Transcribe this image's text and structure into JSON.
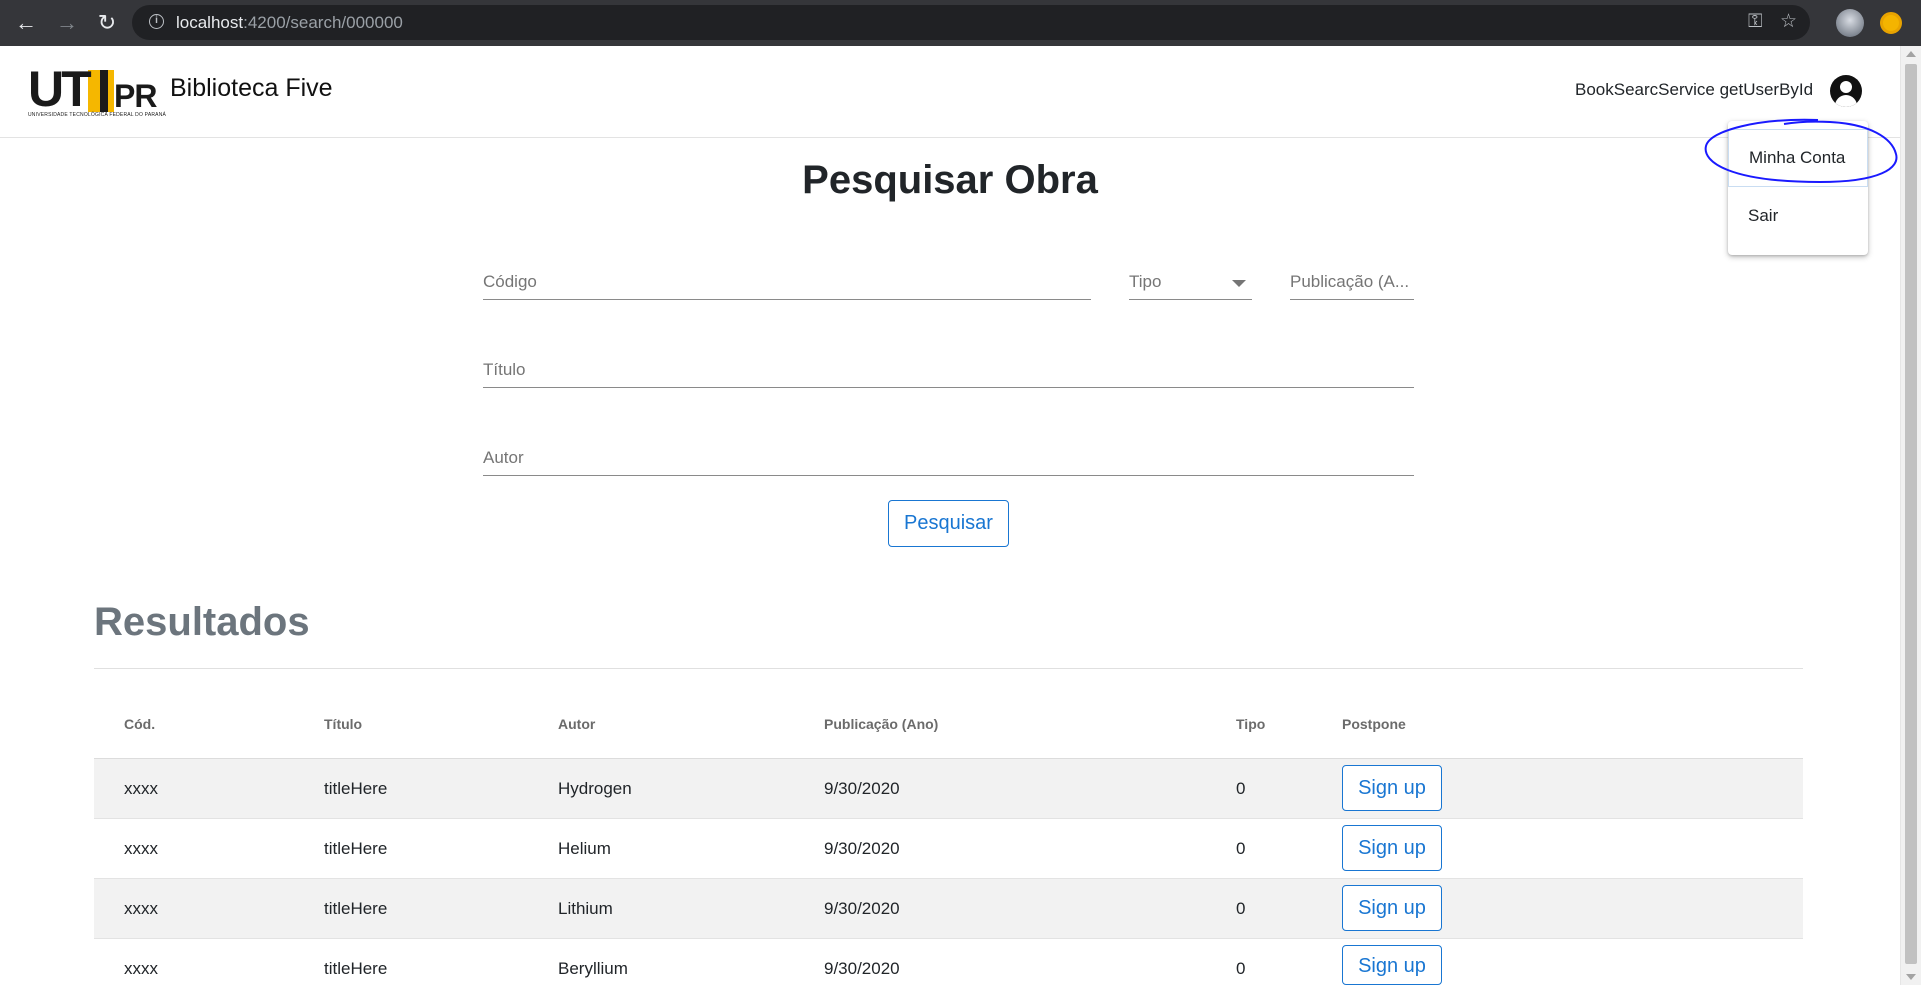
{
  "browser": {
    "url_host": "localhost",
    "url_path": ":4200/search/000000",
    "back_icon": "arrow-left-icon",
    "forward_icon": "arrow-right-icon",
    "reload_icon": "reload-icon",
    "key_icon": "key-icon",
    "star_icon": "star-icon"
  },
  "header": {
    "logo_letters": "UT",
    "logo_pr": "PR",
    "logo_caption": "UNIVERSIDADE TECNOLÓGICA FEDERAL DO PARANÁ",
    "brand": "Biblioteca Five",
    "user_text": "BookSearcService getUserById",
    "user_icon": "account-circle-icon"
  },
  "user_menu": {
    "items": [
      {
        "label": "Minha Conta"
      },
      {
        "label": "Sair"
      }
    ],
    "annotation_color": "#1a1aff"
  },
  "search": {
    "title": "Pesquisar Obra",
    "codigo_label": "Código",
    "tipo_label": "Tipo",
    "publicacao_label": "Publicação (A...",
    "titulo_label": "Título",
    "autor_label": "Autor",
    "submit_label": "Pesquisar"
  },
  "results": {
    "title": "Resultados",
    "columns": [
      "Cód.",
      "Título",
      "Autor",
      "Publicação (Ano)",
      "Tipo",
      "Postpone"
    ],
    "rows": [
      {
        "cod": "xxxx",
        "titulo": "titleHere",
        "autor": "Hydrogen",
        "publicacao": "9/30/2020",
        "tipo": "0",
        "action": "Sign up"
      },
      {
        "cod": "xxxx",
        "titulo": "titleHere",
        "autor": "Helium",
        "publicacao": "9/30/2020",
        "tipo": "0",
        "action": "Sign up"
      },
      {
        "cod": "xxxx",
        "titulo": "titleHere",
        "autor": "Lithium",
        "publicacao": "9/30/2020",
        "tipo": "0",
        "action": "Sign up"
      },
      {
        "cod": "xxxx",
        "titulo": "titleHere",
        "autor": "Beryllium",
        "publicacao": "9/30/2020",
        "tipo": "0",
        "action": "Sign up"
      }
    ]
  },
  "colors": {
    "primary": "#1976d2",
    "chrome_bg": "#35363a",
    "row_shade": "#f2f2f2"
  }
}
